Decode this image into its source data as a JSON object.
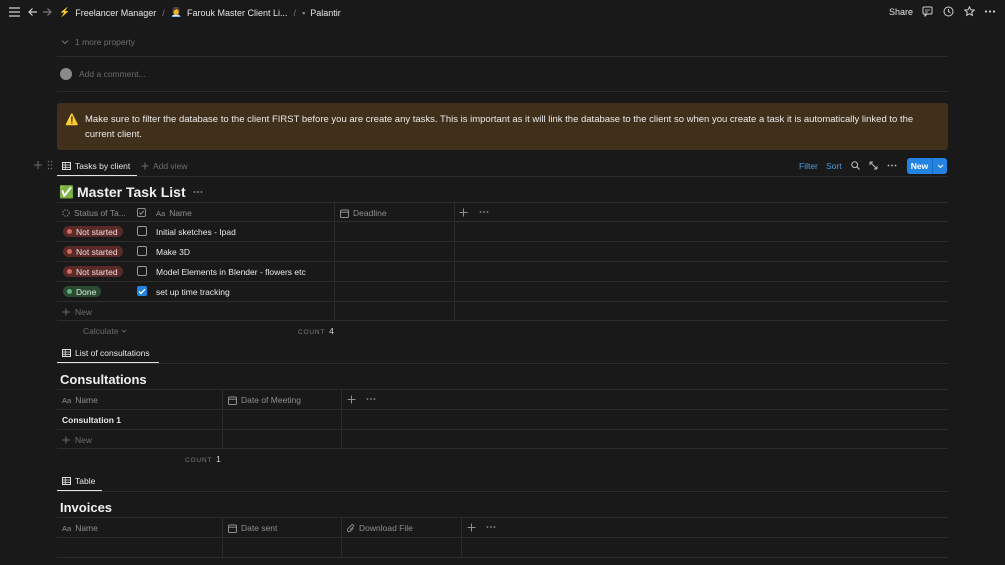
{
  "topbar": {
    "breadcrumbs": [
      {
        "emoji": "⚡",
        "label": "Freelancer Manager"
      },
      {
        "emoji": "👩‍💼",
        "label": "Farouk Master Client Li..."
      },
      {
        "emoji": "▪",
        "label": "Palantir"
      }
    ],
    "share_label": "Share"
  },
  "page": {
    "more_property": "1 more property",
    "add_comment": "Add a comment...",
    "callout": {
      "icon": "⚠️",
      "text": "Make sure to filter the database to the client FIRST before you are create any tasks. This is important as it will link the database to the client so when you create a task it is automatically linked to the current client."
    }
  },
  "tasks_view": {
    "tab_label": "Tasks by client",
    "add_view": "Add view",
    "filter": "Filter",
    "sort": "Sort",
    "new_label": "New",
    "title": "Master Task List",
    "title_icon": "✅",
    "columns": {
      "status": "Status of Ta...",
      "name": "Name",
      "deadline": "Deadline"
    },
    "rows": [
      {
        "status": "Not started",
        "done": false,
        "name": "Initial sketches - Ipad"
      },
      {
        "status": "Not started",
        "done": false,
        "name": "Make 3D"
      },
      {
        "status": "Not started",
        "done": false,
        "name": "Model Elements in Blender - flowers etc"
      },
      {
        "status": "Done",
        "done": true,
        "name": "set up time tracking"
      }
    ],
    "new_row": "New",
    "calculate": "Calculate",
    "count_label": "COUNT",
    "count_value": "4"
  },
  "consultations": {
    "tab_label": "List of consultations",
    "title": "Consultations",
    "columns": {
      "name": "Name",
      "date": "Date of Meeting"
    },
    "rows": [
      {
        "name": "Consultation 1"
      }
    ],
    "new_row": "New",
    "count_label": "COUNT",
    "count_value": "1"
  },
  "invoices": {
    "tab_label": "Table",
    "title": "Invoices",
    "columns": {
      "name": "Name",
      "date": "Date sent",
      "file": "Download File"
    }
  },
  "colors": {
    "background": "#191919",
    "accent": "#2383e2",
    "callout_bg": "#3f2f1b",
    "not_started_bg": "#5a2a28",
    "done_bg": "#2b4a34"
  }
}
